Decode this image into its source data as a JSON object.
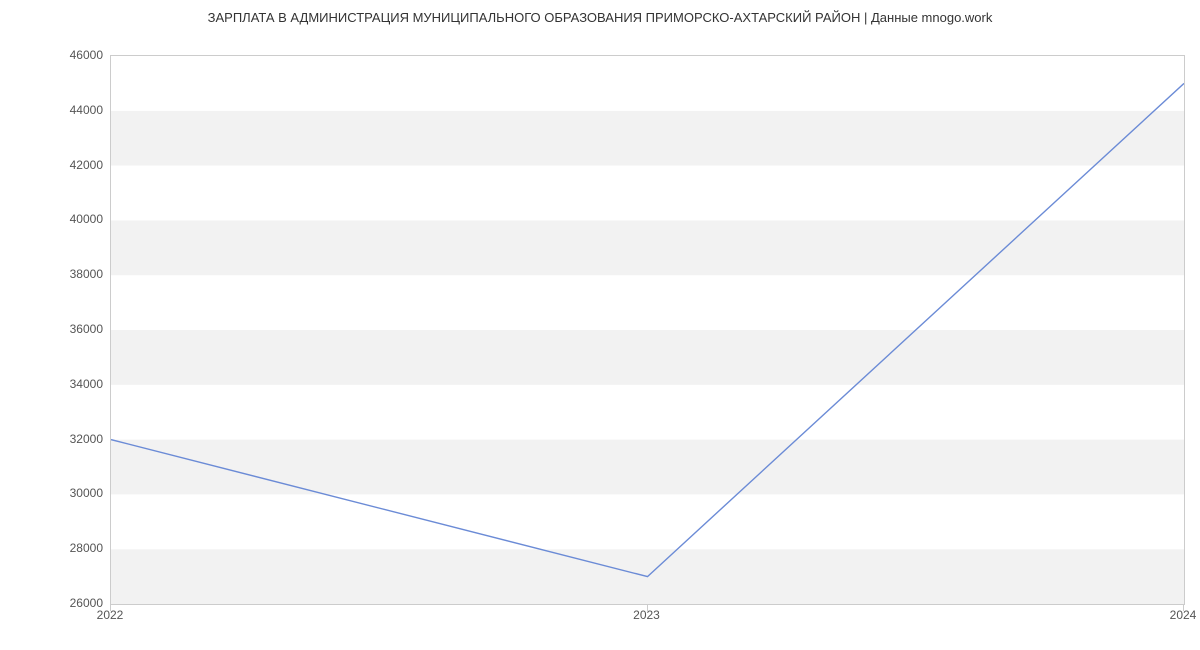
{
  "chart_data": {
    "type": "line",
    "title": "ЗАРПЛАТА В АДМИНИСТРАЦИЯ МУНИЦИПАЛЬНОГО ОБРАЗОВАНИЯ ПРИМОРСКО-АХТАРСКИЙ РАЙОН | Данные mnogo.work",
    "xlabel": "",
    "ylabel": "",
    "x": [
      2022,
      2023,
      2024
    ],
    "values": [
      32000,
      27000,
      45000
    ],
    "x_ticks": [
      2022,
      2023,
      2024
    ],
    "y_ticks": [
      26000,
      28000,
      30000,
      32000,
      34000,
      36000,
      38000,
      40000,
      42000,
      44000,
      46000
    ],
    "ylim": [
      26000,
      46000
    ],
    "xlim": [
      2022,
      2024
    ],
    "line_color": "#6b8bd6",
    "grid": true
  }
}
